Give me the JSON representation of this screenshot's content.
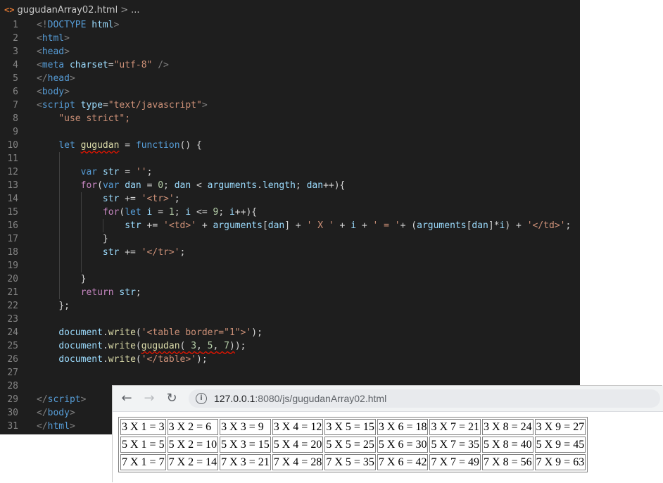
{
  "editor": {
    "breadcrumb": {
      "file": "gugudanArray02.html",
      "sep": ">",
      "more": "..."
    },
    "lines": [
      {
        "n": "1"
      },
      {
        "n": "2"
      },
      {
        "n": "3"
      },
      {
        "n": "4"
      },
      {
        "n": "5"
      },
      {
        "n": "6"
      },
      {
        "n": "7"
      },
      {
        "n": "8"
      },
      {
        "n": "9"
      },
      {
        "n": "10"
      },
      {
        "n": "11"
      },
      {
        "n": "12"
      },
      {
        "n": "13"
      },
      {
        "n": "14"
      },
      {
        "n": "15"
      },
      {
        "n": "16"
      },
      {
        "n": "17"
      },
      {
        "n": "18"
      },
      {
        "n": "19"
      },
      {
        "n": "20"
      },
      {
        "n": "21"
      },
      {
        "n": "22"
      },
      {
        "n": "23"
      },
      {
        "n": "24"
      },
      {
        "n": "25"
      },
      {
        "n": "26"
      },
      {
        "n": "27"
      },
      {
        "n": "28"
      },
      {
        "n": "29"
      },
      {
        "n": "30"
      },
      {
        "n": "31"
      }
    ],
    "code": {
      "doctype": "html",
      "l8": "\"use strict\";",
      "l24_str": "'<table border=\"1\">'",
      "l26_str": "'</table>'"
    }
  },
  "browser": {
    "url_host": "127.0.0.1",
    "url_rest": ":8080/js/gugudanArray02.html",
    "table": [
      [
        "3 X 1 = 3",
        "3 X 2 = 6",
        "3 X 3 = 9",
        "3 X 4 = 12",
        "3 X 5 = 15",
        "3 X 6 = 18",
        "3 X 7 = 21",
        "3 X 8 = 24",
        "3 X 9 = 27"
      ],
      [
        "5 X 1 = 5",
        "5 X 2 = 10",
        "5 X 3 = 15",
        "5 X 4 = 20",
        "5 X 5 = 25",
        "5 X 6 = 30",
        "5 X 7 = 35",
        "5 X 8 = 40",
        "5 X 9 = 45"
      ],
      [
        "7 X 1 = 7",
        "7 X 2 = 14",
        "7 X 3 = 21",
        "7 X 4 = 28",
        "7 X 5 = 35",
        "7 X 6 = 42",
        "7 X 7 = 49",
        "7 X 8 = 56",
        "7 X 9 = 63"
      ]
    ]
  },
  "colors": {
    "editor_bg": "#1e1e1e",
    "tag": "#569cd6",
    "string": "#ce9178",
    "keyword": "#569cd6",
    "control": "#c586c0",
    "function": "#dcdcaa",
    "variable": "#9cdcfe",
    "number": "#b5cea8",
    "error_squiggle": "#e51400"
  },
  "icons": {
    "breadcrumb": "html-file-icon",
    "back": "arrow-left-icon",
    "forward": "arrow-right-icon",
    "reload": "reload-icon",
    "info": "info-icon"
  }
}
